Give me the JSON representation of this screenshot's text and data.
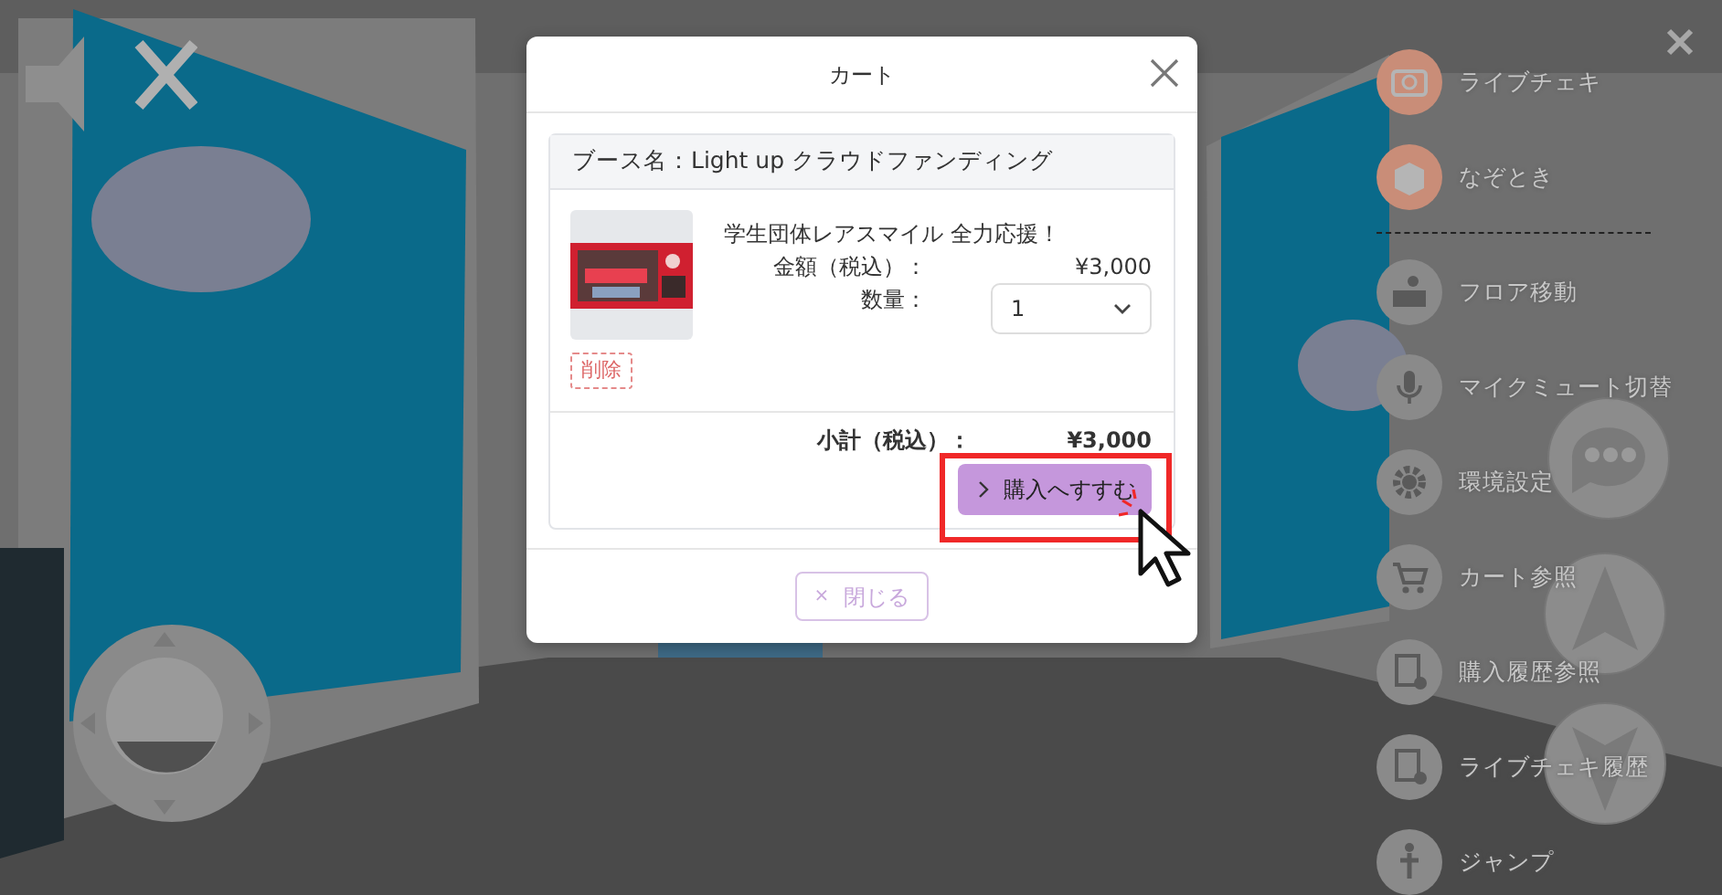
{
  "menu_groups": [
    [
      {
        "label": "ライブチェキ",
        "color": "#c98d78"
      },
      {
        "label": "なぞとき",
        "color": "#c98d78"
      }
    ],
    [
      {
        "label": "フロア移動",
        "color": "#8a8a8a"
      },
      {
        "label": "マイクミュート切替",
        "color": "#8a8a8a"
      },
      {
        "label": "環境設定",
        "color": "#8a8a8a"
      },
      {
        "label": "カート参照",
        "color": "#8a8a8a"
      },
      {
        "label": "購入履歴参照",
        "color": "#8a8a8a"
      },
      {
        "label": "ライブチェキ履歴",
        "color": "#8a8a8a"
      },
      {
        "label": "ジャンプ",
        "color": "#8a8a8a"
      }
    ]
  ],
  "modal": {
    "title": "カート",
    "booth": "ブース名：Light up クラウドファンディング",
    "items": [
      {
        "name": "学生団体レアスマイル 全力応援！",
        "price_label": "金額（税込）：",
        "price": "¥3,000",
        "quantity_label": "数量：",
        "quantity": "1",
        "delete_label": "削除"
      }
    ],
    "subtotal_label": "小計（税込）：",
    "subtotal": "¥3,000",
    "checkout_label": "購入へすすむ",
    "close_button": {
      "icon": "×",
      "label": "閉じる"
    }
  }
}
